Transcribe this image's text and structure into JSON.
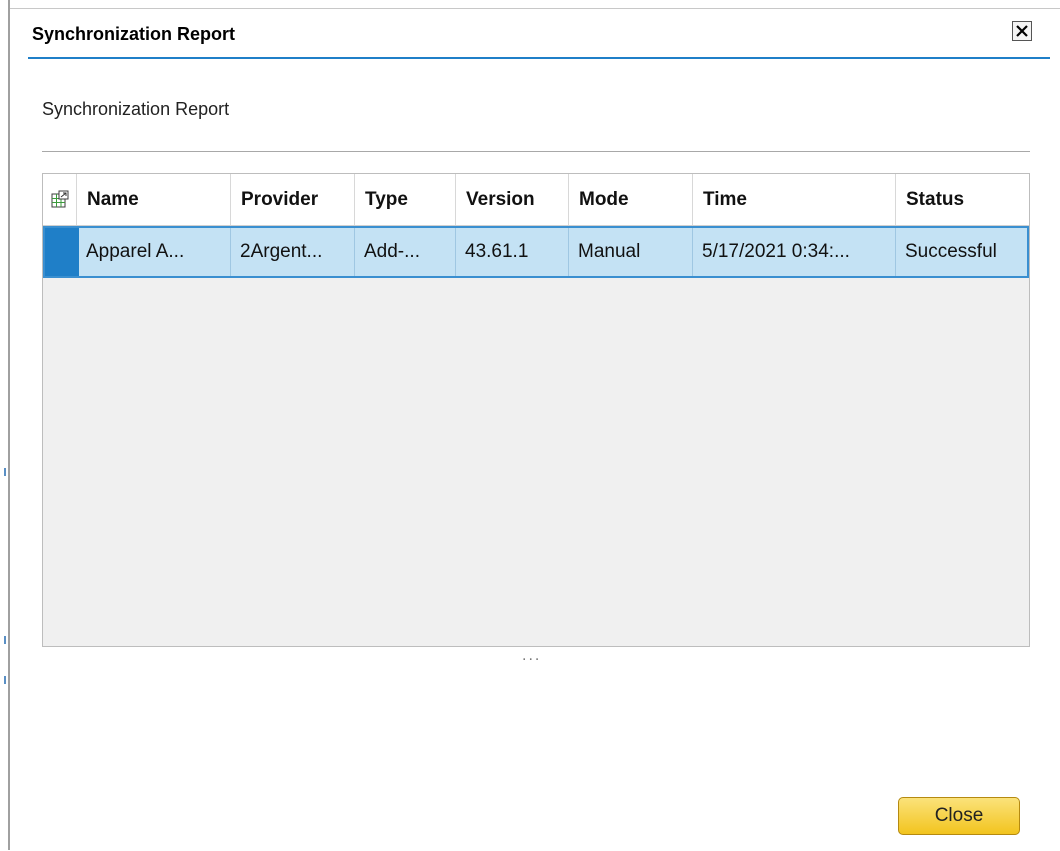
{
  "dialog": {
    "title": "Synchronization Report",
    "close_icon": "close-x-icon"
  },
  "section": {
    "title": "Synchronization Report"
  },
  "grid": {
    "column_layout_icon": "table-settings-icon",
    "columns": [
      "Name",
      "Provider",
      "Type",
      "Version",
      "Mode",
      "Time",
      "Status"
    ],
    "rows": [
      {
        "name": "Apparel A...",
        "provider": "2Argent...",
        "type": "Add-...",
        "version": "43.61.1",
        "mode": "Manual",
        "time": "5/17/2021 0:34:...",
        "status": "Successful"
      }
    ],
    "more_indicator": "..."
  },
  "footer": {
    "close_label": "Close"
  },
  "colors": {
    "accent": "#1f7fc8",
    "selected_row": "#c4e2f4",
    "button": "#f2c41e"
  }
}
